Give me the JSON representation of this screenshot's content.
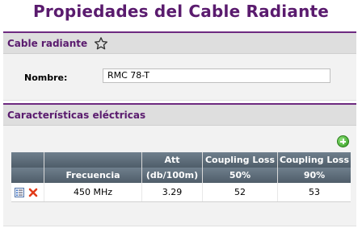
{
  "page_title": "Propiedades del Cable Radiante",
  "cable_panel": {
    "title": "Cable radiante",
    "name_label": "Nombre:",
    "name_value": "RMC 78-T"
  },
  "electrical_panel": {
    "title": "Características eléctricas",
    "columns": [
      {
        "line1": "",
        "line2": ""
      },
      {
        "line1": "",
        "line2": "Frecuencia"
      },
      {
        "line1": "Att",
        "line2": "(db/100m)"
      },
      {
        "line1": "Coupling Loss",
        "line2": "50%"
      },
      {
        "line1": "Coupling Loss",
        "line2": "90%"
      }
    ],
    "rows": [
      {
        "frequency": "450 MHz",
        "att": "3.29",
        "cl50": "52",
        "cl90": "53"
      }
    ]
  },
  "colors": {
    "title": "#5a1b6e",
    "header_bg": "#5f6d79",
    "add": "#2f9a1e",
    "delete": "#e23b1a"
  },
  "icons": [
    "star-icon",
    "add-icon",
    "edit-icon",
    "delete-icon"
  ]
}
